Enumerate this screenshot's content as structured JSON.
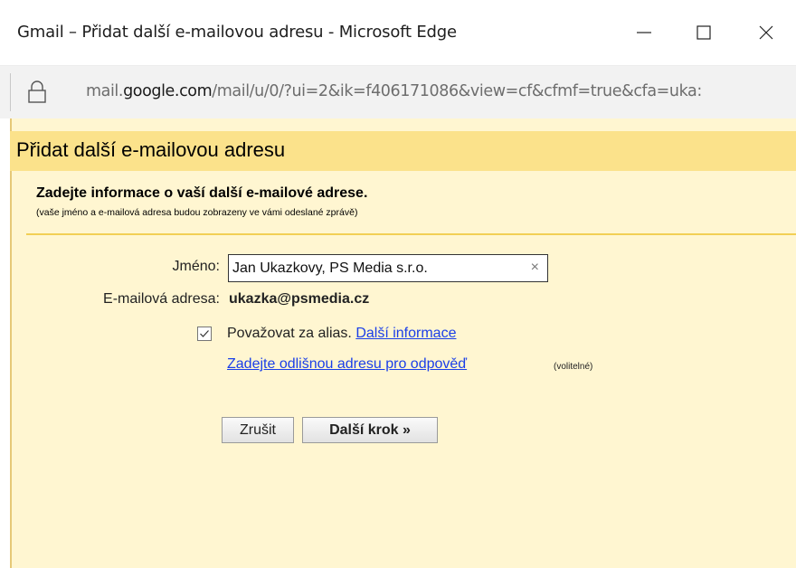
{
  "window": {
    "title": "Gmail – Přidat další e-mailovou adresu - Microsoft Edge",
    "buttons": {
      "minimize": "minimize-icon",
      "maximize": "maximize-icon",
      "close": "close-icon"
    }
  },
  "address_bar": {
    "url_prefix": "mail.",
    "url_domain": "google.com",
    "url_path": "/mail/u/0/?ui=2&ik=f406171086&view=cf&cfmf=true&cfa=uka:",
    "icon": "lock-icon"
  },
  "dialog": {
    "header": "Přidat další e-mailovou adresu",
    "subtitle": "Zadejte informace o vaší další e-mailové adrese.",
    "subnote": "(vaše jméno a e-mailová adresa budou zobrazeny ve vámi odeslané zprávě)",
    "name_label": "Jméno:",
    "name_value": "Jan Ukazkovy, PS Media s.r.o.",
    "clear_glyph": "×",
    "email_label": "E-mailová adresa:",
    "email_value": "ukazka@psmedia.cz",
    "alias_checked": true,
    "alias_label": "Považovat za alias.",
    "alias_link": "Další informace",
    "reply_link": "Zadejte odlišnou adresu pro odpověď",
    "reply_optional": "(volitelné)",
    "cancel_button": "Zrušit",
    "next_button": "Další krok »"
  },
  "colors": {
    "header_bg": "#fbe28b",
    "dialog_bg": "#fff6d1",
    "link": "#1a3ee8",
    "separator": "#f2cf54"
  }
}
